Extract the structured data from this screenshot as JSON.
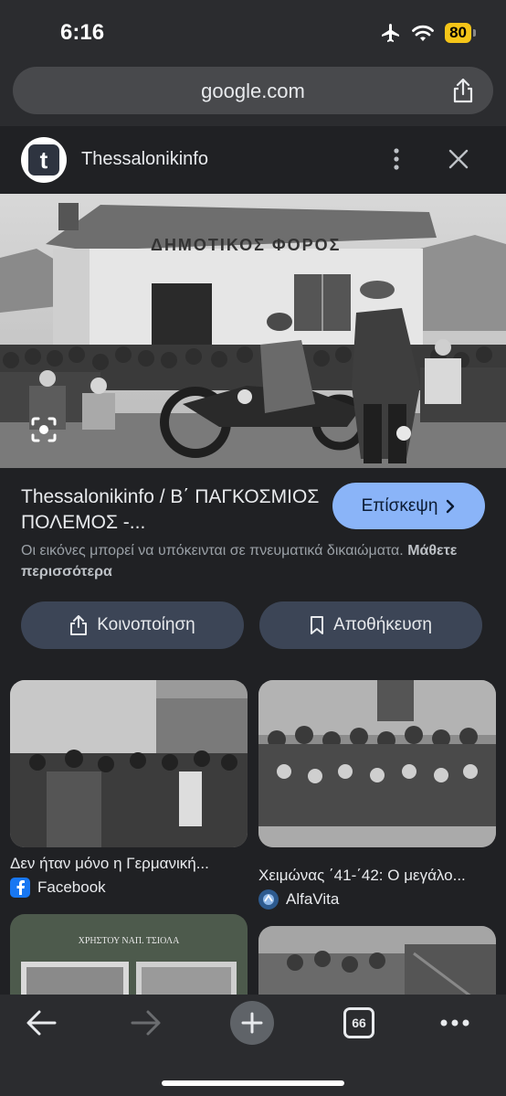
{
  "status": {
    "time": "6:16",
    "battery": "80"
  },
  "browser": {
    "url": "google.com"
  },
  "panel": {
    "site_name": "Thessalonikinfo",
    "logo_letter": "t",
    "title": "Thessalonikinfo / Β΄ ΠΑΓΚΟΣΜΙΟΣ ΠΟΛΕΜΟΣ -...",
    "visit_label": "Επίσκεψη",
    "copyright_text": "Οι εικόνες μπορεί να υπόκεινται σε πνευματικά δικαιώματα.",
    "learn_more": "Μάθετε περισσότερα",
    "share_label": "Κοινοποίηση",
    "save_label": "Αποθήκευση",
    "hero_sign": "ΔΗΜΟΤΙΚΟΣ  ΦΟΡΟΣ"
  },
  "related": [
    {
      "caption": "Δεν ήταν μόνο η Γερμανική...",
      "source": "Facebook",
      "source_color": "#1877f2"
    },
    {
      "caption": "Χειμώνας ΄41-΄42: Ο μεγάλο...",
      "source": "AlfaVita",
      "source_color": "#5b8fd0"
    },
    {
      "caption": "",
      "source": "",
      "book_title": "ΧΡΗΣΤΟΥ ΝΑΠ. ΤΣΙΟΛΑ"
    },
    {
      "caption": "",
      "source": ""
    }
  ],
  "nav": {
    "tab_count": "66"
  }
}
